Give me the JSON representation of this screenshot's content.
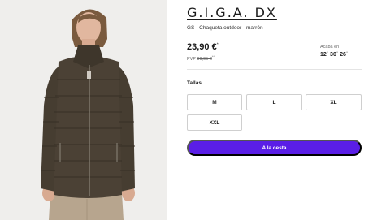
{
  "product": {
    "brand": "G.I.G.A. DX",
    "subtitle": "GS - Chaqueta outdoor - marrón",
    "image_alt": "Mujer con chaqueta acolchada marrón"
  },
  "pricing": {
    "price": "23,90 €",
    "price_marker": "*",
    "rrp_label": "PVP",
    "rrp_value": "99,95 €",
    "rrp_marker": "**"
  },
  "countdown": {
    "label": "Acaba en",
    "value": "12˙ 30˙ 26˙"
  },
  "sizes": {
    "title": "Tallas",
    "options": [
      "M",
      "L",
      "XL",
      "XXL"
    ]
  },
  "cart": {
    "label": "A la cesta",
    "color": "#5a1ee6"
  },
  "colors": {
    "jacket": "#463d31",
    "background": "#efeeec"
  }
}
